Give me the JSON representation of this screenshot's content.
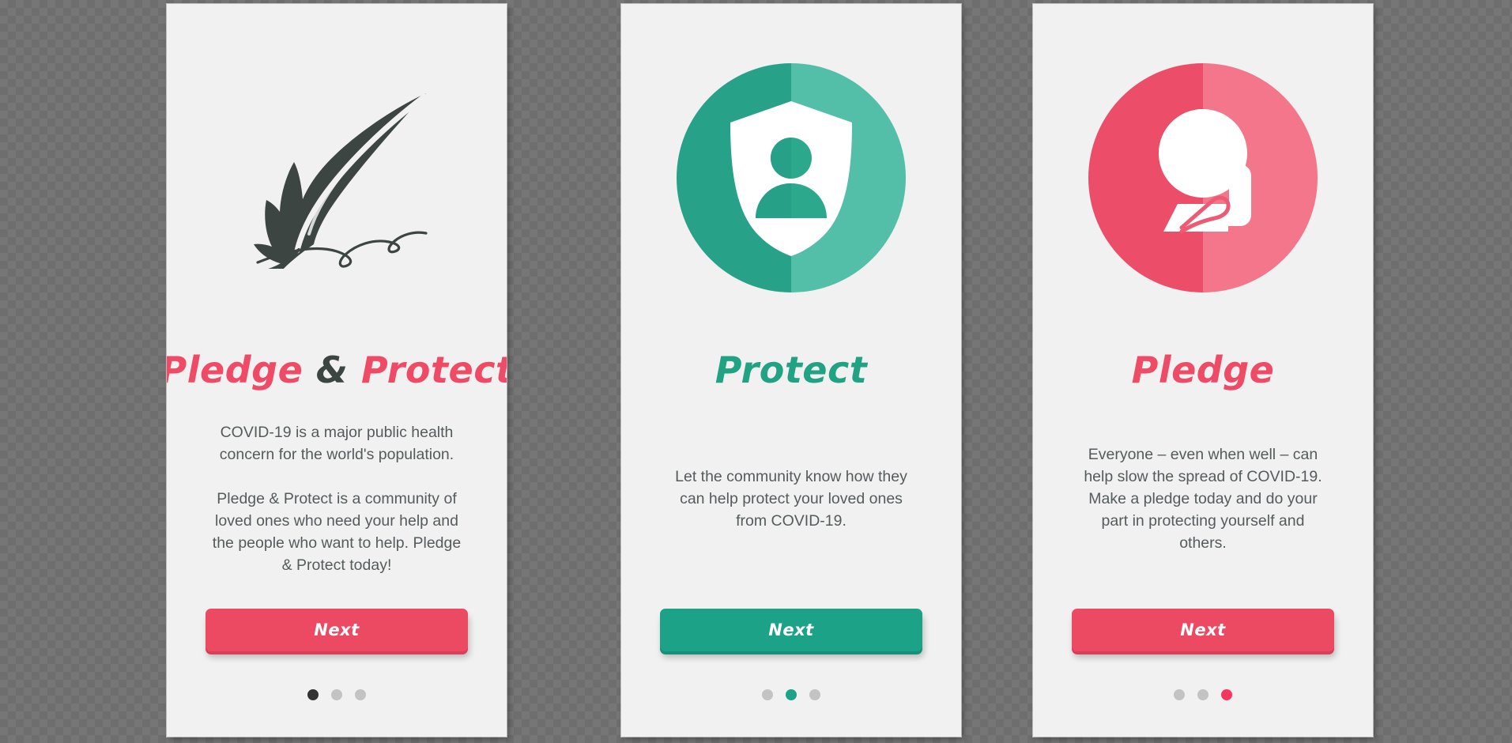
{
  "background": {
    "type": "transparency-checkerboard",
    "colors": [
      "#6e6e6e",
      "#787878"
    ]
  },
  "theme": {
    "panel_bg": "#f1f1f1",
    "pink": "#ef4a66",
    "pink_button": "#ec4a63",
    "pink_dot": "#f9365e",
    "teal": "#21a383",
    "teal_button": "#1ca287",
    "dark_text": "#3d4543",
    "body_text": "#555b5c",
    "dot_inactive": "#c3c3c3",
    "dot_active_dark": "#333333"
  },
  "screens": [
    {
      "id": "screen-1",
      "illustration": "quill-feather-signature-icon",
      "title_parts": [
        {
          "text": "Pledge",
          "color": "pink"
        },
        {
          "text": "&",
          "color": "dark"
        },
        {
          "text": "Protect",
          "color": "pink"
        }
      ],
      "paragraphs": [
        "COVID-19 is a major public health concern for the world's population.",
        "Pledge & Protect is a community of loved ones who need your help and the people who want to help. Pledge & Protect today!"
      ],
      "button_label": "Next",
      "button_style": "pink",
      "dots": {
        "count": 3,
        "active_index": 0,
        "active_color": "dark"
      }
    },
    {
      "id": "screen-2",
      "illustration": "shield-person-circle-icon",
      "title_parts": [
        {
          "text": "Protect",
          "color": "teal"
        }
      ],
      "paragraphs": [
        "Let the community know how they can help protect your loved ones from COVID-19."
      ],
      "button_label": "Next",
      "button_style": "teal",
      "dots": {
        "count": 3,
        "active_index": 1,
        "active_color": "teal"
      }
    },
    {
      "id": "screen-3",
      "illustration": "person-raised-hand-circle-icon",
      "title_parts": [
        {
          "text": "Pledge",
          "color": "pink"
        }
      ],
      "paragraphs": [
        "Everyone – even when well – can help slow the spread of COVID-19. Make a pledge today and do your part in protecting yourself and others."
      ],
      "button_label": "Next",
      "button_style": "pink",
      "dots": {
        "count": 3,
        "active_index": 2,
        "active_color": "pink"
      }
    }
  ]
}
